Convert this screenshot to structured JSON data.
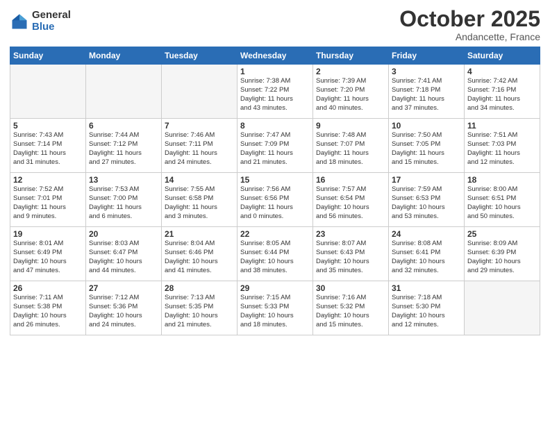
{
  "header": {
    "logo_general": "General",
    "logo_blue": "Blue",
    "month": "October 2025",
    "location": "Andancette, France"
  },
  "days_of_week": [
    "Sunday",
    "Monday",
    "Tuesday",
    "Wednesday",
    "Thursday",
    "Friday",
    "Saturday"
  ],
  "weeks": [
    [
      {
        "day": "",
        "info": ""
      },
      {
        "day": "",
        "info": ""
      },
      {
        "day": "",
        "info": ""
      },
      {
        "day": "1",
        "info": "Sunrise: 7:38 AM\nSunset: 7:22 PM\nDaylight: 11 hours\nand 43 minutes."
      },
      {
        "day": "2",
        "info": "Sunrise: 7:39 AM\nSunset: 7:20 PM\nDaylight: 11 hours\nand 40 minutes."
      },
      {
        "day": "3",
        "info": "Sunrise: 7:41 AM\nSunset: 7:18 PM\nDaylight: 11 hours\nand 37 minutes."
      },
      {
        "day": "4",
        "info": "Sunrise: 7:42 AM\nSunset: 7:16 PM\nDaylight: 11 hours\nand 34 minutes."
      }
    ],
    [
      {
        "day": "5",
        "info": "Sunrise: 7:43 AM\nSunset: 7:14 PM\nDaylight: 11 hours\nand 31 minutes."
      },
      {
        "day": "6",
        "info": "Sunrise: 7:44 AM\nSunset: 7:12 PM\nDaylight: 11 hours\nand 27 minutes."
      },
      {
        "day": "7",
        "info": "Sunrise: 7:46 AM\nSunset: 7:11 PM\nDaylight: 11 hours\nand 24 minutes."
      },
      {
        "day": "8",
        "info": "Sunrise: 7:47 AM\nSunset: 7:09 PM\nDaylight: 11 hours\nand 21 minutes."
      },
      {
        "day": "9",
        "info": "Sunrise: 7:48 AM\nSunset: 7:07 PM\nDaylight: 11 hours\nand 18 minutes."
      },
      {
        "day": "10",
        "info": "Sunrise: 7:50 AM\nSunset: 7:05 PM\nDaylight: 11 hours\nand 15 minutes."
      },
      {
        "day": "11",
        "info": "Sunrise: 7:51 AM\nSunset: 7:03 PM\nDaylight: 11 hours\nand 12 minutes."
      }
    ],
    [
      {
        "day": "12",
        "info": "Sunrise: 7:52 AM\nSunset: 7:01 PM\nDaylight: 11 hours\nand 9 minutes."
      },
      {
        "day": "13",
        "info": "Sunrise: 7:53 AM\nSunset: 7:00 PM\nDaylight: 11 hours\nand 6 minutes."
      },
      {
        "day": "14",
        "info": "Sunrise: 7:55 AM\nSunset: 6:58 PM\nDaylight: 11 hours\nand 3 minutes."
      },
      {
        "day": "15",
        "info": "Sunrise: 7:56 AM\nSunset: 6:56 PM\nDaylight: 11 hours\nand 0 minutes."
      },
      {
        "day": "16",
        "info": "Sunrise: 7:57 AM\nSunset: 6:54 PM\nDaylight: 10 hours\nand 56 minutes."
      },
      {
        "day": "17",
        "info": "Sunrise: 7:59 AM\nSunset: 6:53 PM\nDaylight: 10 hours\nand 53 minutes."
      },
      {
        "day": "18",
        "info": "Sunrise: 8:00 AM\nSunset: 6:51 PM\nDaylight: 10 hours\nand 50 minutes."
      }
    ],
    [
      {
        "day": "19",
        "info": "Sunrise: 8:01 AM\nSunset: 6:49 PM\nDaylight: 10 hours\nand 47 minutes."
      },
      {
        "day": "20",
        "info": "Sunrise: 8:03 AM\nSunset: 6:47 PM\nDaylight: 10 hours\nand 44 minutes."
      },
      {
        "day": "21",
        "info": "Sunrise: 8:04 AM\nSunset: 6:46 PM\nDaylight: 10 hours\nand 41 minutes."
      },
      {
        "day": "22",
        "info": "Sunrise: 8:05 AM\nSunset: 6:44 PM\nDaylight: 10 hours\nand 38 minutes."
      },
      {
        "day": "23",
        "info": "Sunrise: 8:07 AM\nSunset: 6:43 PM\nDaylight: 10 hours\nand 35 minutes."
      },
      {
        "day": "24",
        "info": "Sunrise: 8:08 AM\nSunset: 6:41 PM\nDaylight: 10 hours\nand 32 minutes."
      },
      {
        "day": "25",
        "info": "Sunrise: 8:09 AM\nSunset: 6:39 PM\nDaylight: 10 hours\nand 29 minutes."
      }
    ],
    [
      {
        "day": "26",
        "info": "Sunrise: 7:11 AM\nSunset: 5:38 PM\nDaylight: 10 hours\nand 26 minutes."
      },
      {
        "day": "27",
        "info": "Sunrise: 7:12 AM\nSunset: 5:36 PM\nDaylight: 10 hours\nand 24 minutes."
      },
      {
        "day": "28",
        "info": "Sunrise: 7:13 AM\nSunset: 5:35 PM\nDaylight: 10 hours\nand 21 minutes."
      },
      {
        "day": "29",
        "info": "Sunrise: 7:15 AM\nSunset: 5:33 PM\nDaylight: 10 hours\nand 18 minutes."
      },
      {
        "day": "30",
        "info": "Sunrise: 7:16 AM\nSunset: 5:32 PM\nDaylight: 10 hours\nand 15 minutes."
      },
      {
        "day": "31",
        "info": "Sunrise: 7:18 AM\nSunset: 5:30 PM\nDaylight: 10 hours\nand 12 minutes."
      },
      {
        "day": "",
        "info": ""
      }
    ]
  ]
}
